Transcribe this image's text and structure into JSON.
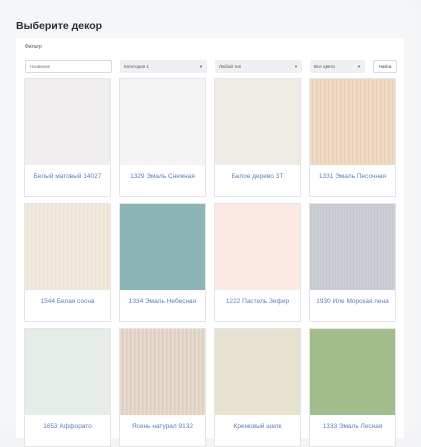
{
  "page": {
    "title": "Выберите декор"
  },
  "filter": {
    "label": "Фильтр",
    "search_placeholder": "Название",
    "category_value": "Категория 1",
    "type_value": "Любой тип",
    "color_value": "Все цвета",
    "find_label": "Найти"
  },
  "decors": [
    {
      "name": "Белый матовый 14027",
      "color": "#f0eeee",
      "texture": "plain"
    },
    {
      "name": "1329 Эмаль Снежная",
      "color": "#f8f8f8",
      "texture": "fine"
    },
    {
      "name": "Белое дерево 3Т",
      "color": "#efebe5",
      "texture": "plain"
    },
    {
      "name": "1331 Эмаль Песочная",
      "color": "#efd7bd",
      "texture": "wood"
    },
    {
      "name": "1544 Белая сосна",
      "color": "#f1e8d9",
      "texture": "wood"
    },
    {
      "name": "1334 Эмаль Небесная",
      "color": "#8db4b5",
      "texture": "plain"
    },
    {
      "name": "1222 Пастель Зефир",
      "color": "#fde9e4",
      "texture": "plain"
    },
    {
      "name": "1930 Иле Морская пена",
      "color": "#c7ccd3",
      "texture": "fine"
    },
    {
      "name": "1653 Аффорато",
      "color": "#e6ece6",
      "texture": "plain"
    },
    {
      "name": "Ясень натурал 9132",
      "color": "#e2d3c4",
      "texture": "wood"
    },
    {
      "name": "Кремовый шелк",
      "color": "#e7e2cf",
      "texture": "plain"
    },
    {
      "name": "1333 Эмаль Лесная",
      "color": "#a3bc8b",
      "texture": "plain"
    }
  ]
}
